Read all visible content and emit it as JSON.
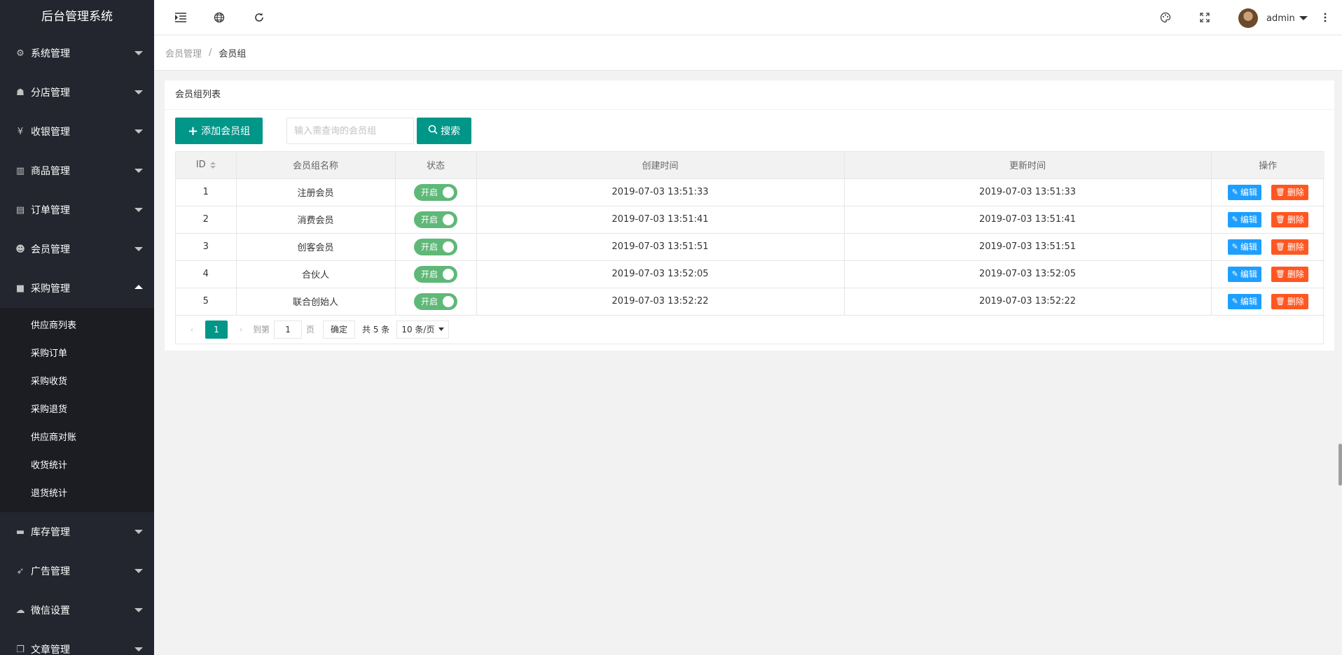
{
  "app_title": "后台管理系统",
  "sidebar": {
    "items": [
      {
        "label": "系统管理",
        "icon": "gear-icon",
        "glyph": "⚙"
      },
      {
        "label": "分店管理",
        "icon": "shop-icon",
        "glyph": "☗"
      },
      {
        "label": "收银管理",
        "icon": "yen-icon",
        "glyph": "¥"
      },
      {
        "label": "商品管理",
        "icon": "bar-chart-icon",
        "glyph": "▥"
      },
      {
        "label": "订单管理",
        "icon": "calendar-icon",
        "glyph": "▤"
      },
      {
        "label": "会员管理",
        "icon": "users-icon",
        "glyph": "☻"
      },
      {
        "label": "采购管理",
        "icon": "briefcase-icon",
        "glyph": "■"
      },
      {
        "label": "库存管理",
        "icon": "folder-icon",
        "glyph": "▬"
      },
      {
        "label": "广告管理",
        "icon": "rocket-icon",
        "glyph": "➶"
      },
      {
        "label": "微信设置",
        "icon": "wechat-icon",
        "glyph": "☁"
      },
      {
        "label": "文章管理",
        "icon": "copy-icon",
        "glyph": "❐"
      }
    ],
    "open_submenu": [
      "供应商列表",
      "采购订单",
      "采购收货",
      "采购退货",
      "供应商对账",
      "收货统计",
      "退货统计"
    ]
  },
  "header": {
    "user_name": "admin"
  },
  "breadcrumb": {
    "parent": "会员管理",
    "separator": "/",
    "current": "会员组"
  },
  "card": {
    "title": "会员组列表",
    "add_label": "添加会员组",
    "search_placeholder": "输入需查询的会员组",
    "search_label": "搜索"
  },
  "table": {
    "headers": [
      "ID",
      "会员组名称",
      "状态",
      "创建时间",
      "更新时间",
      "操作"
    ],
    "status_label": "开启",
    "edit_label": "编辑",
    "delete_label": "删除",
    "rows": [
      {
        "id": "1",
        "name": "注册会员",
        "created": "2019-07-03 13:51:33",
        "updated": "2019-07-03 13:51:33"
      },
      {
        "id": "2",
        "name": "消费会员",
        "created": "2019-07-03 13:51:41",
        "updated": "2019-07-03 13:51:41"
      },
      {
        "id": "3",
        "name": "创客会员",
        "created": "2019-07-03 13:51:51",
        "updated": "2019-07-03 13:51:51"
      },
      {
        "id": "4",
        "name": "合伙人",
        "created": "2019-07-03 13:52:05",
        "updated": "2019-07-03 13:52:05"
      },
      {
        "id": "5",
        "name": "联合创始人",
        "created": "2019-07-03 13:52:22",
        "updated": "2019-07-03 13:52:22"
      }
    ]
  },
  "pager": {
    "current": "1",
    "goto_label": "到第",
    "goto_value": "1",
    "page_unit": "页",
    "confirm": "确定",
    "total": "共 5 条",
    "page_size": "10 条/页"
  },
  "colors": {
    "sidebar_bg": "#23262e",
    "primary": "#009688",
    "switch_on": "#5fb878",
    "edit": "#1e9fff",
    "delete": "#ff5722"
  }
}
